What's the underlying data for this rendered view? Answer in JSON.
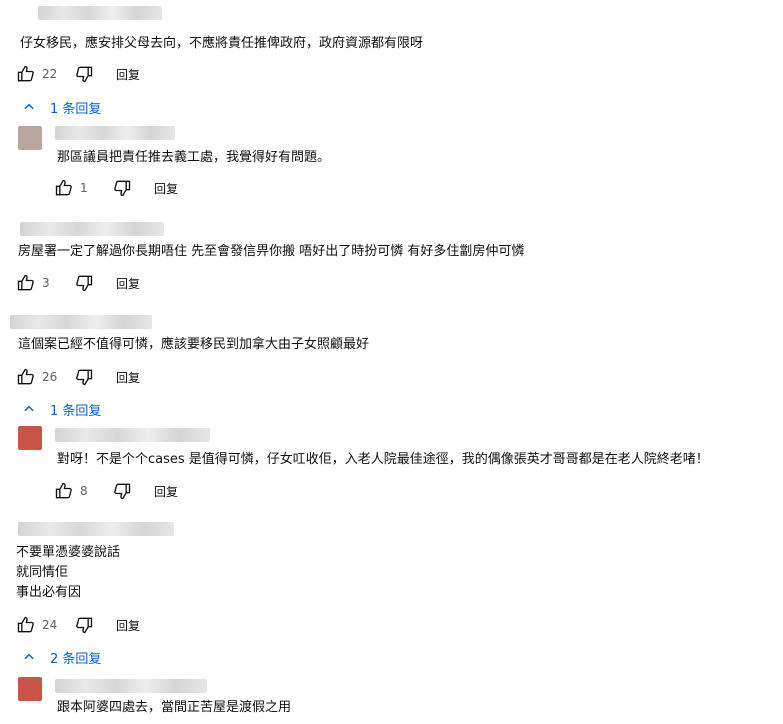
{
  "comments": [
    {
      "text_lines": [
        "仔女移民，應安排父母去向，不應將責任推俾政府，政府資源都有限呀"
      ],
      "likes": "22",
      "reply_label": "回复",
      "replies_toggle": "1 条回复"
    },
    {
      "text_lines": [
        "那區議員把責任推去義工處，我覺得好有問題。"
      ],
      "likes": "1",
      "reply_label": "回复",
      "is_reply": true
    },
    {
      "text_lines": [
        "房屋署一定了解過你長期唔住 先至會發信畀你搬 唔好出了時扮可憐 有好多住劏房仲可憐"
      ],
      "likes": "3",
      "reply_label": "回复"
    },
    {
      "text_lines": [
        "這個案已經不值得可憐，應該要移民到加拿大由子女照顧最好"
      ],
      "likes": "26",
      "reply_label": "回复",
      "replies_toggle": "1 条回复"
    },
    {
      "text_lines": [
        "對呀！不是个个cases 是值得可憐，仔女叿收佢，入老人院最佳途徑，我的偶像張英才哥哥都是在老人院終老啫！"
      ],
      "likes": "8",
      "reply_label": "回复",
      "is_reply": true
    },
    {
      "text_lines": [
        "不要單憑婆婆說話",
        "就同情佢",
        "事出必有因"
      ],
      "likes": "24",
      "reply_label": "回复",
      "replies_toggle": "2 条回复"
    },
    {
      "text_lines": [
        "跟本阿婆四處去，當間正苦屋是渡假之用"
      ],
      "is_reply": true
    }
  ],
  "icons": {
    "like": "thumbs-up-icon",
    "dislike": "thumbs-down-icon",
    "chevron": "chevron-up-icon"
  },
  "colors": {
    "link": "#065fd4",
    "muted": "#606060",
    "text": "#0f0f0f"
  }
}
